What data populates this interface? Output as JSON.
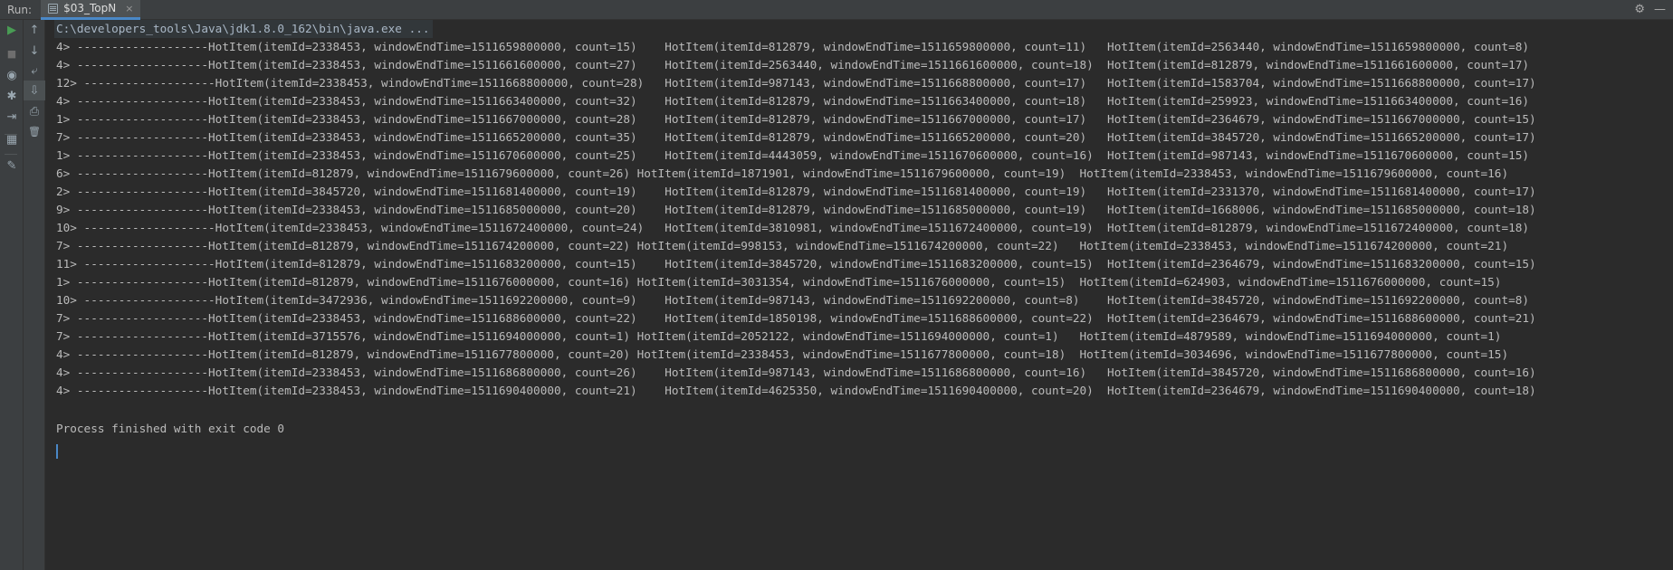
{
  "run_bar": {
    "label": "Run:",
    "tab_label": "$03_TopN",
    "tab_close": "×",
    "gear_glyph": "⚙",
    "hide_glyph": "—"
  },
  "toolbar": {
    "rerun": "▶",
    "stop": "■",
    "screenshot": "◉",
    "debug": "✱",
    "exit": "⇥",
    "layout": "▦",
    "pin": "✎",
    "up": "↑",
    "down": "↓",
    "wrap": "⤶",
    "scroll_end": "⇩",
    "print": "⎙",
    "trash": "🗑"
  },
  "console": {
    "command": "C:\\developers_tools\\Java\\jdk1.8.0_162\\bin\\java.exe ...",
    "lines": [
      "4> -------------------HotItem(itemId=2338453, windowEndTime=1511659800000, count=15)    HotItem(itemId=812879, windowEndTime=1511659800000, count=11)   HotItem(itemId=2563440, windowEndTime=1511659800000, count=8)",
      "4> -------------------HotItem(itemId=2338453, windowEndTime=1511661600000, count=27)    HotItem(itemId=2563440, windowEndTime=1511661600000, count=18)  HotItem(itemId=812879, windowEndTime=1511661600000, count=17)",
      "12> -------------------HotItem(itemId=2338453, windowEndTime=1511668800000, count=28)   HotItem(itemId=987143, windowEndTime=1511668800000, count=17)   HotItem(itemId=1583704, windowEndTime=1511668800000, count=17)",
      "4> -------------------HotItem(itemId=2338453, windowEndTime=1511663400000, count=32)    HotItem(itemId=812879, windowEndTime=1511663400000, count=18)   HotItem(itemId=259923, windowEndTime=1511663400000, count=16)",
      "1> -------------------HotItem(itemId=2338453, windowEndTime=1511667000000, count=28)    HotItem(itemId=812879, windowEndTime=1511667000000, count=17)   HotItem(itemId=2364679, windowEndTime=1511667000000, count=15)",
      "7> -------------------HotItem(itemId=2338453, windowEndTime=1511665200000, count=35)    HotItem(itemId=812879, windowEndTime=1511665200000, count=20)   HotItem(itemId=3845720, windowEndTime=1511665200000, count=17)",
      "1> -------------------HotItem(itemId=2338453, windowEndTime=1511670600000, count=25)    HotItem(itemId=4443059, windowEndTime=1511670600000, count=16)  HotItem(itemId=987143, windowEndTime=1511670600000, count=15)",
      "6> -------------------HotItem(itemId=812879, windowEndTime=1511679600000, count=26) HotItem(itemId=1871901, windowEndTime=1511679600000, count=19)  HotItem(itemId=2338453, windowEndTime=1511679600000, count=16)",
      "2> -------------------HotItem(itemId=3845720, windowEndTime=1511681400000, count=19)    HotItem(itemId=812879, windowEndTime=1511681400000, count=19)   HotItem(itemId=2331370, windowEndTime=1511681400000, count=17)",
      "9> -------------------HotItem(itemId=2338453, windowEndTime=1511685000000, count=20)    HotItem(itemId=812879, windowEndTime=1511685000000, count=19)   HotItem(itemId=1668006, windowEndTime=1511685000000, count=18)",
      "10> -------------------HotItem(itemId=2338453, windowEndTime=1511672400000, count=24)   HotItem(itemId=3810981, windowEndTime=1511672400000, count=19)  HotItem(itemId=812879, windowEndTime=1511672400000, count=18)",
      "7> -------------------HotItem(itemId=812879, windowEndTime=1511674200000, count=22) HotItem(itemId=998153, windowEndTime=1511674200000, count=22)   HotItem(itemId=2338453, windowEndTime=1511674200000, count=21)",
      "11> -------------------HotItem(itemId=812879, windowEndTime=1511683200000, count=15)    HotItem(itemId=3845720, windowEndTime=1511683200000, count=15)  HotItem(itemId=2364679, windowEndTime=1511683200000, count=15)",
      "1> -------------------HotItem(itemId=812879, windowEndTime=1511676000000, count=16) HotItem(itemId=3031354, windowEndTime=1511676000000, count=15)  HotItem(itemId=624903, windowEndTime=1511676000000, count=15)",
      "10> -------------------HotItem(itemId=3472936, windowEndTime=1511692200000, count=9)    HotItem(itemId=987143, windowEndTime=1511692200000, count=8)    HotItem(itemId=3845720, windowEndTime=1511692200000, count=8)",
      "7> -------------------HotItem(itemId=2338453, windowEndTime=1511688600000, count=22)    HotItem(itemId=1850198, windowEndTime=1511688600000, count=22)  HotItem(itemId=2364679, windowEndTime=1511688600000, count=21)",
      "7> -------------------HotItem(itemId=3715576, windowEndTime=1511694000000, count=1) HotItem(itemId=2052122, windowEndTime=1511694000000, count=1)   HotItem(itemId=4879589, windowEndTime=1511694000000, count=1)",
      "4> -------------------HotItem(itemId=812879, windowEndTime=1511677800000, count=20) HotItem(itemId=2338453, windowEndTime=1511677800000, count=18)  HotItem(itemId=3034696, windowEndTime=1511677800000, count=15)",
      "4> -------------------HotItem(itemId=2338453, windowEndTime=1511686800000, count=26)    HotItem(itemId=987143, windowEndTime=1511686800000, count=16)   HotItem(itemId=3845720, windowEndTime=1511686800000, count=16)",
      "4> -------------------HotItem(itemId=2338453, windowEndTime=1511690400000, count=21)    HotItem(itemId=4625350, windowEndTime=1511690400000, count=20)  HotItem(itemId=2364679, windowEndTime=1511690400000, count=18)"
    ],
    "exit_message": "Process finished with exit code 0"
  }
}
